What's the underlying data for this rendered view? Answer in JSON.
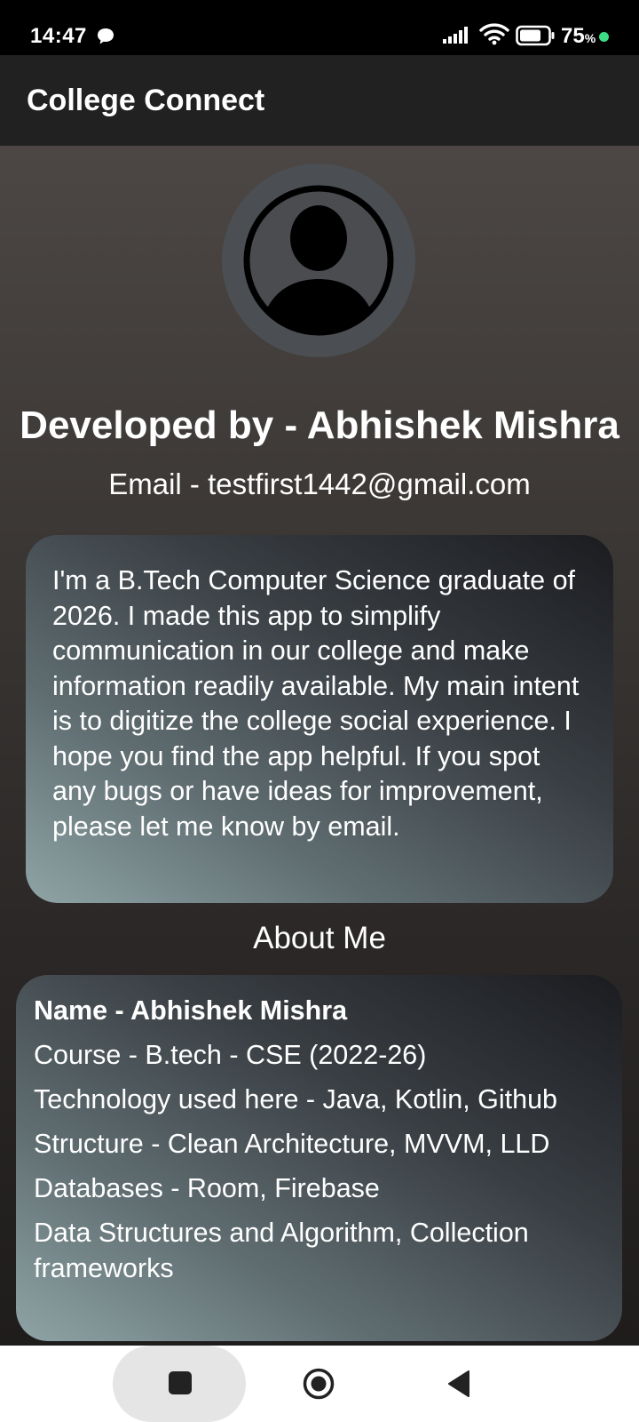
{
  "status_bar": {
    "time": "14:47",
    "battery_percent": "75",
    "battery_unit": "%",
    "notification_icon": "chat-bubble-icon",
    "signal_icon": "signal-icon",
    "wifi_icon": "wifi-icon",
    "battery_icon": "battery-icon"
  },
  "app_bar": {
    "title": "College Connect"
  },
  "profile": {
    "avatar_icon": "person-silhouette-icon",
    "developer": "Developed by - Abhishek Mishra",
    "email": "Email - testfirst1442@gmail.com"
  },
  "bio": {
    "text": "I'm a B.Tech Computer Science graduate of 2026. I made this app to simplify communication in our college and make information readily available. My main intent is to digitize the college social experience. I hope you find the app helpful. If you spot any bugs or have ideas for improvement, please let me know by email."
  },
  "about": {
    "title": "About Me",
    "lines": [
      "Name - Abhishek Mishra",
      "Course - B.tech - CSE  (2022-26)",
      "Technology used here  - Java, Kotlin, Github",
      "Structure - Clean Architecture, MVVM, LLD",
      "Databases - Room, Firebase",
      "Data Structures and Algorithm, Collection frameworks"
    ]
  },
  "nav_bar": {
    "recent_icon": "square-recents-icon",
    "home_icon": "circle-home-icon",
    "back_icon": "triangle-back-icon"
  },
  "colors": {
    "status_bar_bg": "#000000",
    "app_bar_bg": "#212121",
    "avatar_bg": "#4b4e52",
    "card_gradient_light": "#8fa4a6",
    "card_gradient_dark": "#1b1c20",
    "battery_dot": "#3ddc84"
  }
}
